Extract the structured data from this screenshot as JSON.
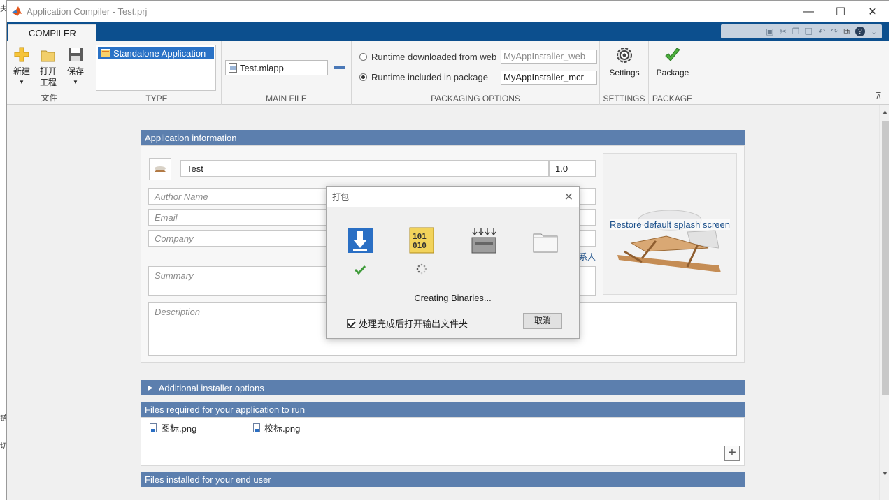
{
  "background": {
    "frag1": "夫",
    "frag2": "链",
    "frag3": "切"
  },
  "window": {
    "title": "Application Compiler - Test.prj",
    "minimize": "—",
    "maximize": "☐",
    "close": "✕"
  },
  "toolstrip": {
    "tab": "COMPILER",
    "file_group": {
      "label": "文件",
      "new": "新建",
      "open": "打开\n工程",
      "save": "保存"
    },
    "type_group": {
      "label": "TYPE",
      "selected": "Standalone Application"
    },
    "main_file_group": {
      "label": "MAIN FILE",
      "file": "Test.mlapp"
    },
    "packaging_group": {
      "label": "PACKAGING OPTIONS",
      "runtime_web": "Runtime downloaded from web",
      "runtime_web_value": "MyAppInstaller_web",
      "runtime_pkg": "Runtime included in package",
      "runtime_pkg_value": "MyAppInstaller_mcr"
    },
    "settings_group": {
      "label": "SETTINGS",
      "button": "Settings"
    },
    "package_group": {
      "label": "PACKAGE",
      "button": "Package"
    }
  },
  "app_info": {
    "header": "Application information",
    "name": "Test",
    "version": "1.0",
    "author_placeholder": "Author Name",
    "email_placeholder": "Email",
    "company_placeholder": "Company",
    "contact_link": "系人",
    "summary_placeholder": "Summary",
    "description_placeholder": "Description",
    "splash_link": "Restore default splash screen"
  },
  "additional_options": {
    "header": "Additional installer options"
  },
  "files_required": {
    "header": "Files required for your application to run",
    "files": [
      "图标.png",
      "校标.png"
    ]
  },
  "files_installed": {
    "header": "Files installed for your end user"
  },
  "dialog": {
    "title": "打包",
    "close": "✕",
    "status": "Creating Binaries...",
    "open_folder_label": "处理完成后打开输出文件夹",
    "cancel": "取消"
  },
  "colors": {
    "tab_bar": "#0c4f8e",
    "panel_header": "#5c7fae",
    "selection": "#2a72c6"
  }
}
